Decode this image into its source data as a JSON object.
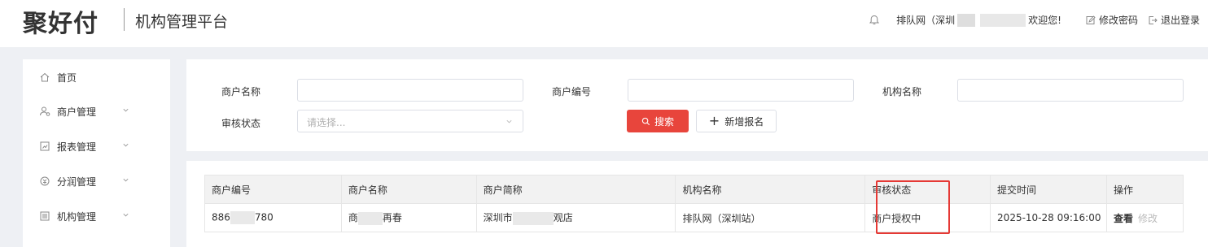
{
  "header": {
    "logo": "聚好付",
    "platform_title": "机构管理平台",
    "welcome_prefix": "排队网（深圳",
    "welcome_suffix": "欢迎您!",
    "change_password": "修改密码",
    "logout": "退出登录"
  },
  "sidebar": {
    "items": [
      {
        "label": "首页",
        "icon": "home-icon"
      },
      {
        "label": "商户管理",
        "icon": "merchant-icon"
      },
      {
        "label": "报表管理",
        "icon": "report-icon"
      },
      {
        "label": "分润管理",
        "icon": "profit-icon"
      },
      {
        "label": "机构管理",
        "icon": "org-icon"
      }
    ]
  },
  "search": {
    "merchant_name_label": "商户名称",
    "merchant_no_label": "商户编号",
    "org_name_label": "机构名称",
    "audit_status_label": "审核状态",
    "audit_status_placeholder": "请选择...",
    "search_button": "搜索",
    "add_button": "新增报名"
  },
  "table": {
    "columns": [
      "商户编号",
      "商户名称",
      "商户简称",
      "机构名称",
      "审核状态",
      "提交时间",
      "操作"
    ],
    "rows": [
      {
        "merchant_no_a": "886",
        "merchant_no_b": "780",
        "merchant_name_a": "商",
        "merchant_name_b": "再春",
        "short_name_a": "深圳市",
        "short_name_b": "观店",
        "org_name": "排队网（深圳站）",
        "audit_status": "商户授权中",
        "submit_time": "2025-10-28 09:16:00",
        "op_view": "查看",
        "op_edit": "修改"
      }
    ]
  },
  "colors": {
    "accent": "#e8453c",
    "highlight_box": "#e53935"
  }
}
